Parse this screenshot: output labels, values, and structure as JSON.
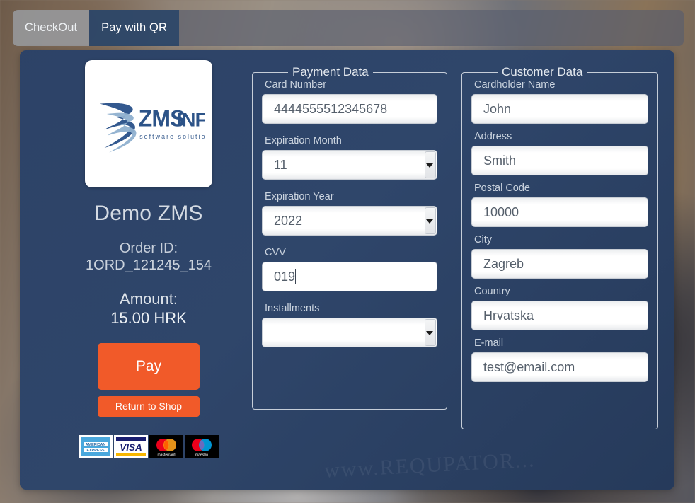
{
  "tabs": [
    {
      "label": "CheckOut",
      "active": true
    },
    {
      "label": "Pay with QR",
      "active": false
    }
  ],
  "colors": {
    "accent_orange": "#f15a29",
    "card_navy": "#2f4568",
    "tab_active_gray": "#a0a0a0",
    "tab_inactive_navy": "#284468",
    "field_white": "#ffffff"
  },
  "merchant": {
    "logo_text_primary": "ZMS",
    "logo_text_secondary": "INFO",
    "logo_tagline": "software solutions",
    "name": "Demo ZMS",
    "order_id_label": "Order ID:",
    "order_id_value": "1ORD_121245_154",
    "amount_label": "Amount:",
    "amount_value": "15.00 HRK",
    "pay_button": "Pay",
    "return_button": "Return to Shop"
  },
  "card_brands": [
    {
      "name": "American Express",
      "short": "AMERICAN EXPRESS"
    },
    {
      "name": "Visa",
      "short": "VISA"
    },
    {
      "name": "Mastercard",
      "short": "mastercard"
    },
    {
      "name": "Maestro",
      "short": "maestro"
    }
  ],
  "payment": {
    "legend": "Payment Data",
    "card_number": {
      "label": "Card Number",
      "value": "4444555512345678"
    },
    "expiration_month": {
      "label": "Expiration Month",
      "value": "11"
    },
    "expiration_year": {
      "label": "Expiration Year",
      "value": "2022"
    },
    "cvv": {
      "label": "CVV",
      "value": "019",
      "focused": true
    },
    "installments": {
      "label": "Installments",
      "value": ""
    }
  },
  "customer": {
    "legend": "Customer Data",
    "cardholder_name": {
      "label": "Cardholder Name",
      "value": "John"
    },
    "address": {
      "label": "Address",
      "value": "Smith"
    },
    "postal_code": {
      "label": "Postal Code",
      "value": "10000"
    },
    "city": {
      "label": "City",
      "value": "Zagreb"
    },
    "country": {
      "label": "Country",
      "value": "Hrvatska"
    },
    "email": {
      "label": "E-mail",
      "value": "test@email.com"
    }
  },
  "background": {
    "watermark": "www.REQUPATOR..."
  }
}
